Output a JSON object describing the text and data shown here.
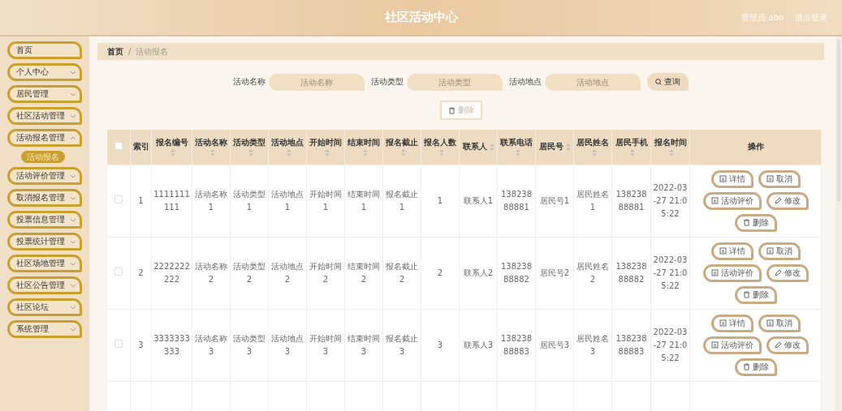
{
  "header": {
    "title": "社区活动中心",
    "user": "管理员 abo",
    "logout": "退出登录"
  },
  "sidebar": {
    "items": [
      {
        "label": "首页",
        "kind": "link"
      },
      {
        "label": "个人中心",
        "kind": "menu",
        "expanded": false
      },
      {
        "label": "居民管理",
        "kind": "menu",
        "expanded": false
      },
      {
        "label": "社区活动管理",
        "kind": "menu",
        "expanded": false
      },
      {
        "label": "活动报名管理",
        "kind": "menu",
        "expanded": true,
        "children": [
          {
            "label": "活动报名",
            "selected": true
          }
        ]
      },
      {
        "label": "活动评价管理",
        "kind": "menu",
        "expanded": false
      },
      {
        "label": "取消报名管理",
        "kind": "menu",
        "expanded": false
      },
      {
        "label": "投票信息管理",
        "kind": "menu",
        "expanded": false
      },
      {
        "label": "投票统计管理",
        "kind": "menu",
        "expanded": false
      },
      {
        "label": "社区场地管理",
        "kind": "menu",
        "expanded": false
      },
      {
        "label": "社区公告管理",
        "kind": "menu",
        "expanded": false
      },
      {
        "label": "社区论坛",
        "kind": "menu",
        "expanded": false
      },
      {
        "label": "系统管理",
        "kind": "menu",
        "expanded": false
      }
    ]
  },
  "breadcrumb": {
    "separator": "/",
    "items": [
      "首页",
      "活动报名"
    ]
  },
  "search": {
    "fields": [
      {
        "label": "活动名称",
        "placeholder": "活动名称"
      },
      {
        "label": "活动类型",
        "placeholder": "活动类型"
      },
      {
        "label": "活动地点",
        "placeholder": "活动地点"
      }
    ],
    "button": "查询"
  },
  "delete_button": {
    "label": "删除",
    "disabled": true
  },
  "table": {
    "select_all": false,
    "columns": [
      {
        "label": "索引",
        "sortable": false
      },
      {
        "label": "报名编号",
        "sortable": true
      },
      {
        "label": "活动名称",
        "sortable": true
      },
      {
        "label": "活动类型",
        "sortable": true
      },
      {
        "label": "活动地点",
        "sortable": true
      },
      {
        "label": "开始时间",
        "sortable": true
      },
      {
        "label": "结束时间",
        "sortable": true
      },
      {
        "label": "报名截止",
        "sortable": true
      },
      {
        "label": "报名人数",
        "sortable": true
      },
      {
        "label": "联系人",
        "sortable": true
      },
      {
        "label": "联系电话",
        "sortable": true
      },
      {
        "label": "居民号",
        "sortable": true
      },
      {
        "label": "居民姓名",
        "sortable": true
      },
      {
        "label": "居民手机",
        "sortable": true
      },
      {
        "label": "报名时间",
        "sortable": true
      },
      {
        "label": "操作",
        "sortable": false
      }
    ],
    "rows": [
      {
        "selected": false,
        "cells": [
          "1",
          "1111111111",
          "活动名称1",
          "活动类型1",
          "活动地点1",
          "开始时间1",
          "结束时间1",
          "报名截止1",
          "1",
          "联系人1",
          "13823888881",
          "居民号1",
          "居民姓名1",
          "13823888881",
          "2022-03-27 21:05:22"
        ],
        "actions": [
          {
            "label": "详情",
            "kind": "detail"
          },
          {
            "label": "取消",
            "kind": "cancel"
          },
          {
            "label": "活动评价",
            "kind": "review"
          },
          {
            "label": "修改",
            "kind": "edit"
          },
          {
            "label": "删除",
            "kind": "delete"
          }
        ]
      },
      {
        "selected": false,
        "cells": [
          "2",
          "2222222222",
          "活动名称2",
          "活动类型2",
          "活动地点2",
          "开始时间2",
          "结束时间2",
          "报名截止2",
          "2",
          "联系人2",
          "13823888882",
          "居民号2",
          "居民姓名2",
          "13823888882",
          "2022-03-27 21:05:22"
        ],
        "actions": [
          {
            "label": "详情",
            "kind": "detail"
          },
          {
            "label": "取消",
            "kind": "cancel"
          },
          {
            "label": "活动评价",
            "kind": "review"
          },
          {
            "label": "修改",
            "kind": "edit"
          },
          {
            "label": "删除",
            "kind": "delete"
          }
        ]
      },
      {
        "selected": false,
        "cells": [
          "3",
          "3333333333",
          "活动名称3",
          "活动类型3",
          "活动地点3",
          "开始时间3",
          "结束时间3",
          "报名截止3",
          "3",
          "联系人3",
          "13823888883",
          "居民号3",
          "居民姓名3",
          "13823888883",
          "2022-03-27 21:05:22"
        ],
        "actions": [
          {
            "label": "详情",
            "kind": "detail"
          },
          {
            "label": "取消",
            "kind": "cancel"
          },
          {
            "label": "活动评价",
            "kind": "review"
          },
          {
            "label": "修改",
            "kind": "edit"
          },
          {
            "label": "删除",
            "kind": "delete"
          }
        ]
      }
    ]
  }
}
